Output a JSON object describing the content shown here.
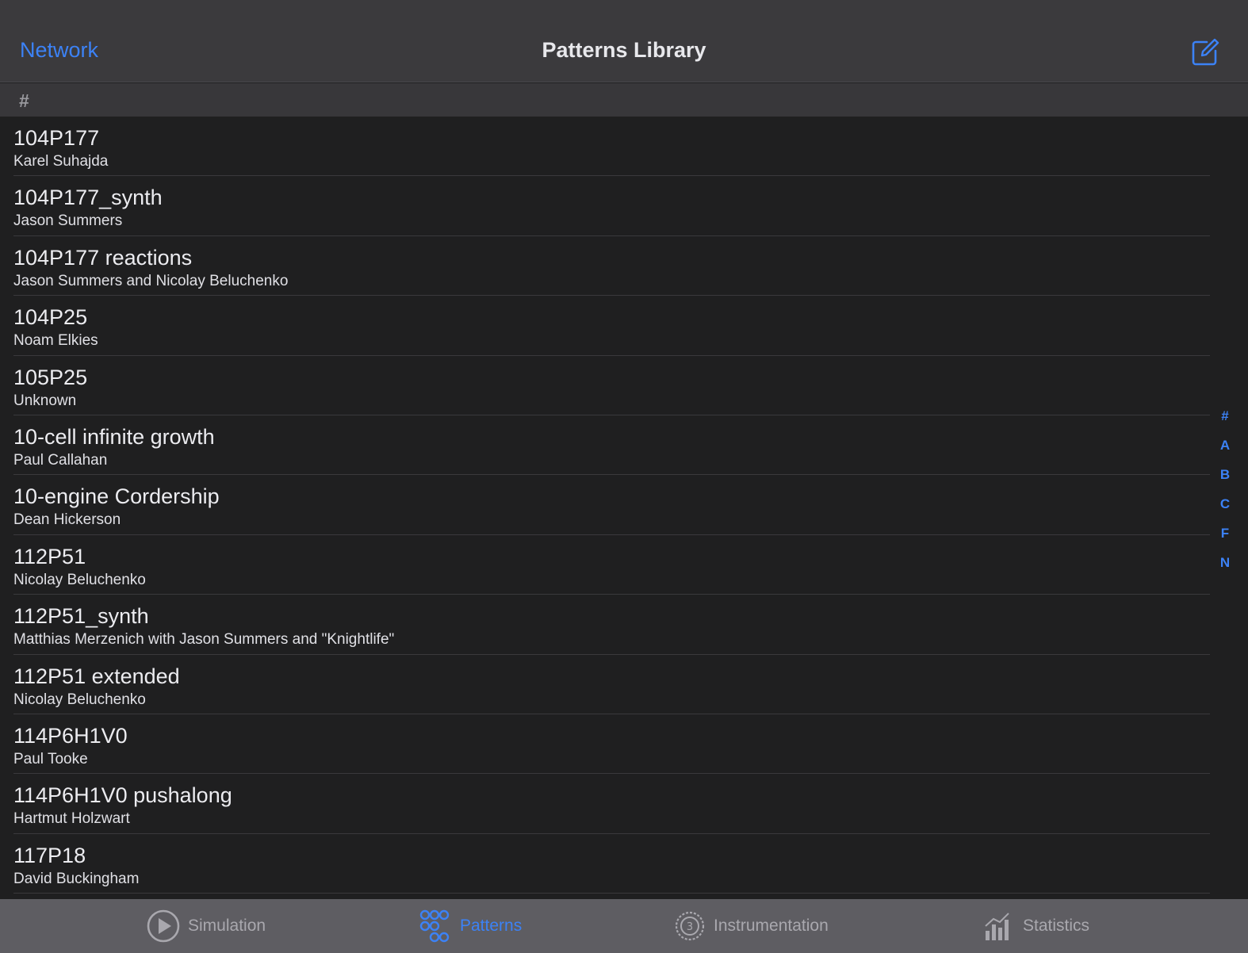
{
  "nav": {
    "back_label": "Network",
    "title": "Patterns Library"
  },
  "section_header": "#",
  "patterns": [
    {
      "name": "104P177",
      "author": "Karel Suhajda"
    },
    {
      "name": "104P177_synth",
      "author": "Jason Summers"
    },
    {
      "name": "104P177 reactions",
      "author": "Jason Summers and Nicolay Beluchenko"
    },
    {
      "name": "104P25",
      "author": "Noam Elkies"
    },
    {
      "name": "105P25",
      "author": "Unknown"
    },
    {
      "name": "10-cell infinite growth",
      "author": "Paul Callahan"
    },
    {
      "name": "10-engine Cordership",
      "author": "Dean Hickerson"
    },
    {
      "name": "112P51",
      "author": "Nicolay Beluchenko"
    },
    {
      "name": "112P51_synth",
      "author": "Matthias Merzenich with Jason Summers and \"Knightlife\""
    },
    {
      "name": "112P51 extended",
      "author": "Nicolay Beluchenko"
    },
    {
      "name": "114P6H1V0",
      "author": "Paul Tooke"
    },
    {
      "name": "114P6H1V0 pushalong",
      "author": "Hartmut Holzwart"
    },
    {
      "name": "117P18",
      "author": "David Buckingham"
    }
  ],
  "index_letters": [
    "#",
    "A",
    "B",
    "C",
    "F",
    "N"
  ],
  "tabs": [
    {
      "label": "Simulation",
      "icon": "play-circle-icon",
      "active": false
    },
    {
      "label": "Patterns",
      "icon": "patterns-icon",
      "active": true
    },
    {
      "label": "Instrumentation",
      "icon": "gauge-icon",
      "active": false
    },
    {
      "label": "Statistics",
      "icon": "chart-icon",
      "active": false
    }
  ],
  "colors": {
    "accent": "#3c82f6",
    "background": "#1f1f20",
    "navbar": "#3b3a3d",
    "tabbar": "#5e5d62"
  }
}
